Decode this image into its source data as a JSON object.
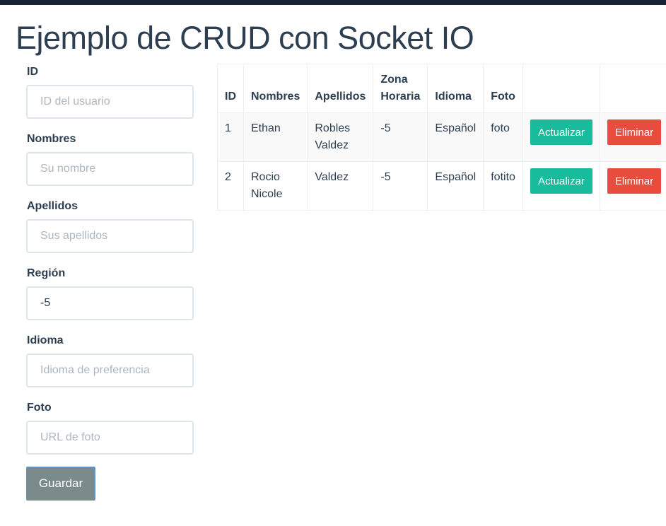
{
  "page": {
    "title": "Ejemplo de CRUD con Socket IO"
  },
  "form": {
    "fields": [
      {
        "label": "ID",
        "placeholder": "ID del usuario",
        "value": ""
      },
      {
        "label": "Nombres",
        "placeholder": "Su nombre",
        "value": ""
      },
      {
        "label": "Apellidos",
        "placeholder": "Sus apellidos",
        "value": ""
      },
      {
        "label": "Región",
        "placeholder": "",
        "value": "-5"
      },
      {
        "label": "Idioma",
        "placeholder": "Idioma de preferencia",
        "value": ""
      },
      {
        "label": "Foto",
        "placeholder": "URL de foto",
        "value": ""
      }
    ],
    "save_label": "Guardar"
  },
  "table": {
    "headers": [
      "ID",
      "Nombres",
      "Apellidos",
      "Zona Horaria",
      "Idioma",
      "Foto"
    ],
    "rows": [
      {
        "id": "1",
        "nombres": "Ethan",
        "apellidos": "Robles Valdez",
        "zona": "-5",
        "idioma": "Español",
        "foto": "foto",
        "update_label": "Actualizar",
        "delete_label": "Eliminar"
      },
      {
        "id": "2",
        "nombres": "Rocio Nicole",
        "apellidos": "Valdez",
        "zona": "-5",
        "idioma": "Español",
        "foto": "fotito",
        "update_label": "Actualizar",
        "delete_label": "Eliminar"
      }
    ]
  },
  "colors": {
    "primary_text": "#2c3e50",
    "update_button": "#18bc9c",
    "delete_button": "#e74c3c",
    "save_button": "#7b8a8b",
    "topbar": "#1a2238"
  }
}
